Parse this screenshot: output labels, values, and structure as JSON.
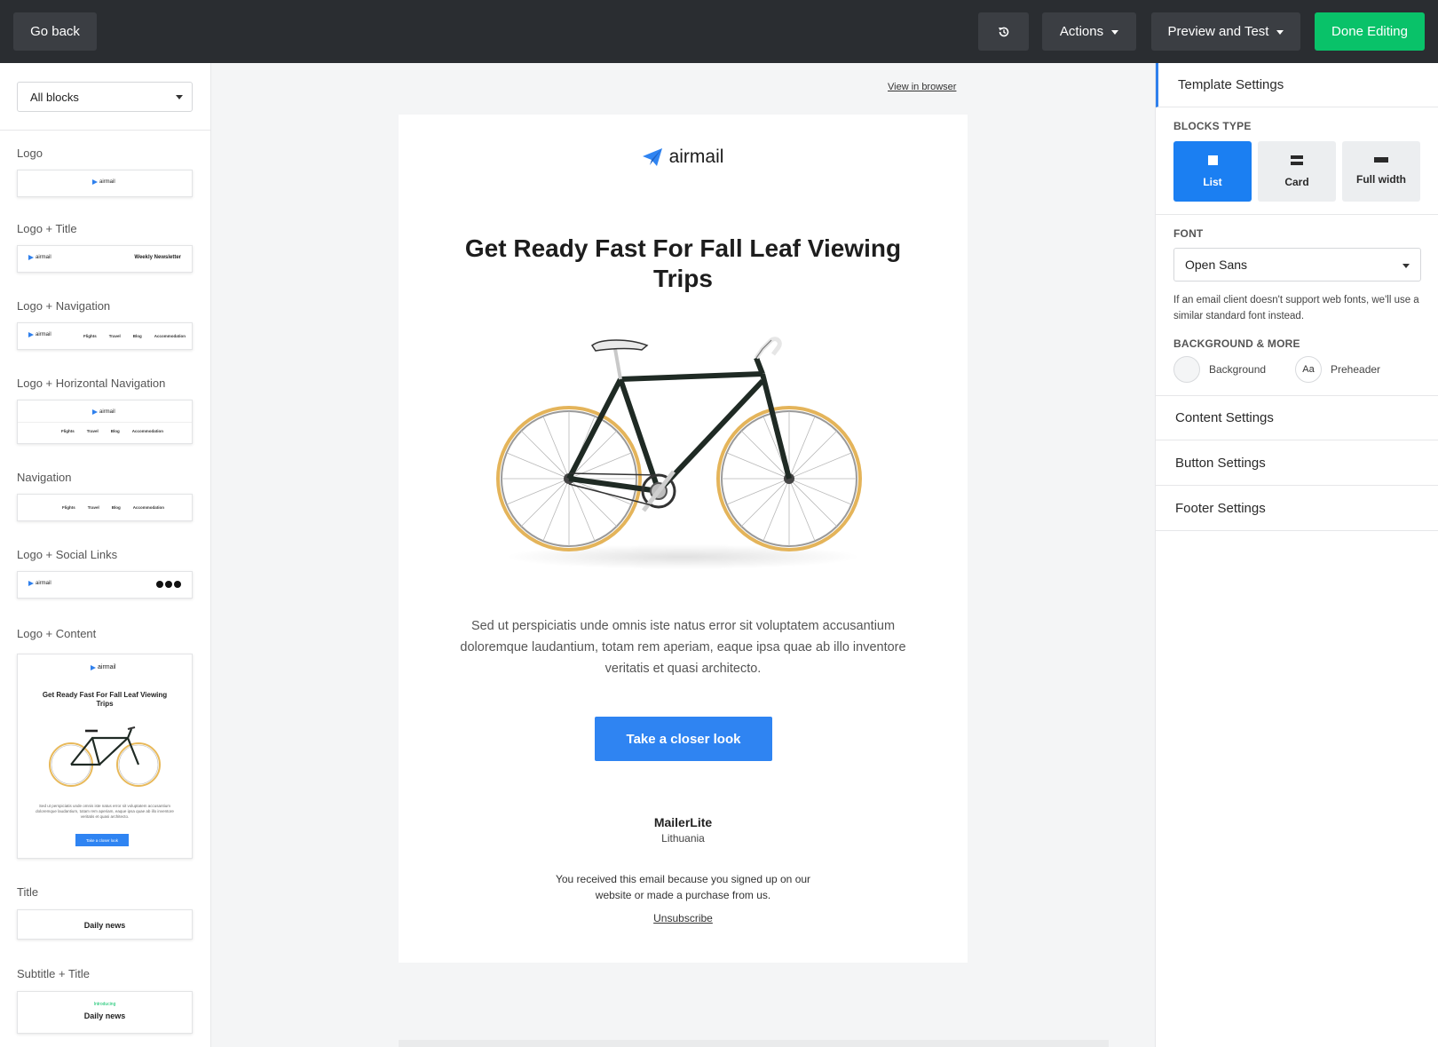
{
  "topbar": {
    "back_label": "Go back",
    "history_icon": "history-icon",
    "actions_label": "Actions",
    "preview_label": "Preview and Test",
    "done_label": "Done Editing",
    "done_color": "#09c269"
  },
  "left": {
    "filter_value": "All blocks",
    "blocks": [
      {
        "label": "Logo"
      },
      {
        "label": "Logo + Title",
        "title": "Weekly Newsletter"
      },
      {
        "label": "Logo + Navigation",
        "nav": [
          "Flights",
          "Travel",
          "Blog",
          "Accommodation"
        ]
      },
      {
        "label": "Logo + Horizontal Navigation",
        "nav": [
          "Flights",
          "Travel",
          "Blog",
          "Accommodation"
        ]
      },
      {
        "label": "Navigation",
        "nav": [
          "Flights",
          "Travel",
          "Blog",
          "Accommodation"
        ]
      },
      {
        "label": "Logo + Social Links"
      },
      {
        "label": "Logo + Content",
        "title": "Get Ready Fast For Fall Leaf Viewing Trips",
        "body": "Sed ut perspiciatis unde omnis iste natus error sit voluptatem accusantium doloremque laudantium, totam rem aperiam, eaque ipsa quae ab illo inventore veritatis et quasi architecto.",
        "button": "Take a closer look"
      },
      {
        "label": "Title",
        "title": "Daily news"
      },
      {
        "label": "Subtitle + Title",
        "subtitle": "Introducing",
        "title": "Daily news"
      }
    ],
    "logo_text": "airmail"
  },
  "canvas": {
    "view_in_browser": "View in browser",
    "email": {
      "logo_text": "airmail",
      "title": "Get Ready Fast For Fall Leaf Viewing Trips",
      "body": "Sed ut perspiciatis unde omnis iste natus error sit voluptatem accusantium doloremque laudantium, totam rem aperiam, eaque ipsa quae ab illo inventore veritatis et quasi architecto.",
      "cta": "Take a closer look",
      "company": "MailerLite",
      "country": "Lithuania",
      "reason": "You received this email because you signed up on our website or made a purchase from us.",
      "unsubscribe": "Unsubscribe",
      "accent": "#2f84f2"
    }
  },
  "right": {
    "template_settings": "Template Settings",
    "blocks_type_caption": "BLOCKS TYPE",
    "block_types": [
      "List",
      "Card",
      "Full width"
    ],
    "selected_block_type": "List",
    "font_caption": "FONT",
    "font_value": "Open Sans",
    "font_note": "If an email client doesn't support web fonts, we'll use a similar standard font instead.",
    "bg_caption": "BACKGROUND & MORE",
    "background_label": "Background",
    "preheader_label": "Preheader",
    "preheader_swatch": "Aa",
    "content_settings": "Content Settings",
    "button_settings": "Button Settings",
    "footer_settings": "Footer Settings"
  }
}
